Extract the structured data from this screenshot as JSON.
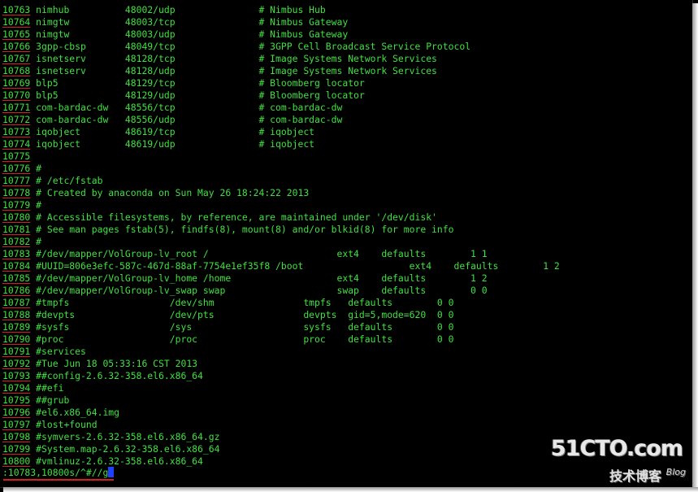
{
  "terminal": {
    "lines": [
      {
        "num": "10763",
        "text": " nimhub          48002/udp               # Nimbus Hub"
      },
      {
        "num": "10764",
        "text": " nimgtw          48003/tcp               # Nimbus Gateway"
      },
      {
        "num": "10765",
        "text": " nimgtw          48003/udp               # Nimbus Gateway"
      },
      {
        "num": "10766",
        "text": " 3gpp-cbsp       48049/tcp               # 3GPP Cell Broadcast Service Protocol"
      },
      {
        "num": "10767",
        "text": " isnetserv       48128/tcp               # Image Systems Network Services"
      },
      {
        "num": "10768",
        "text": " isnetserv       48128/udp               # Image Systems Network Services"
      },
      {
        "num": "10769",
        "text": " blp5            48129/tcp               # Bloomberg locator"
      },
      {
        "num": "10770",
        "text": " blp5            48129/udp               # Bloomberg locator"
      },
      {
        "num": "10771",
        "text": " com-bardac-dw   48556/tcp               # com-bardac-dw"
      },
      {
        "num": "10772",
        "text": " com-bardac-dw   48556/udp               # com-bardac-dw"
      },
      {
        "num": "10773",
        "text": " iqobject        48619/tcp               # iqobject"
      },
      {
        "num": "10774",
        "text": " iqobject        48619/udp               # iqobject"
      },
      {
        "num": "10775",
        "text": " "
      },
      {
        "num": "10776",
        "text": " #"
      },
      {
        "num": "10777",
        "text": " # /etc/fstab"
      },
      {
        "num": "10778",
        "text": " # Created by anaconda on Sun May 26 18:24:22 2013"
      },
      {
        "num": "10779",
        "text": " #"
      },
      {
        "num": "10780",
        "text": " # Accessible filesystems, by reference, are maintained under '/dev/disk'"
      },
      {
        "num": "10781",
        "text": " # See man pages fstab(5), findfs(8), mount(8) and/or blkid(8) for more info"
      },
      {
        "num": "10782",
        "text": " #"
      },
      {
        "num": "10783",
        "text": " #/dev/mapper/VolGroup-lv_root /                       ext4    defaults        1 1"
      },
      {
        "num": "10784",
        "text": " #UUID=806e3efc-587c-467d-88af-7754e1ef35f8 /boot                   ext4    defaults        1 2"
      },
      {
        "num": "10785",
        "text": " #/dev/mapper/VolGroup-lv_home /home                   ext4    defaults        1 2"
      },
      {
        "num": "10786",
        "text": " #/dev/mapper/VolGroup-lv_swap swap                    swap    defaults        0 0"
      },
      {
        "num": "10787",
        "text": " #tmpfs                  /dev/shm                tmpfs   defaults        0 0"
      },
      {
        "num": "10788",
        "text": " #devpts                 /dev/pts                devpts  gid=5,mode=620  0 0"
      },
      {
        "num": "10789",
        "text": " #sysfs                  /sys                    sysfs   defaults        0 0"
      },
      {
        "num": "10790",
        "text": " #proc                   /proc                   proc    defaults        0 0"
      },
      {
        "num": "10791",
        "text": " #services"
      },
      {
        "num": "10792",
        "text": " #Tue Jun 18 05:33:16 CST 2013"
      },
      {
        "num": "10793",
        "text": " ##config-2.6.32-358.el6.x86_64"
      },
      {
        "num": "10794",
        "text": " ##efi"
      },
      {
        "num": "10795",
        "text": " ##grub"
      },
      {
        "num": "10796",
        "text": " #el6.x86_64.img"
      },
      {
        "num": "10797",
        "text": " #lost+found"
      },
      {
        "num": "10798",
        "text": " #symvers-2.6.32-358.el6.x86_64.gz"
      },
      {
        "num": "10799",
        "text": " #System.map-2.6.32-358.el6.x86_64"
      },
      {
        "num": "10800",
        "text": " #vmlinuz-2.6.32-358.el6.x86_64"
      }
    ],
    "command": ":10783,10800s/^#//g",
    "text_color": "#40e040",
    "cursor_color": "#2040ff",
    "underline_color": "#d02020",
    "background": "#000000"
  },
  "watermark": {
    "main": "51CTO.com",
    "sub": "技术博客",
    "blog": "Blog"
  }
}
